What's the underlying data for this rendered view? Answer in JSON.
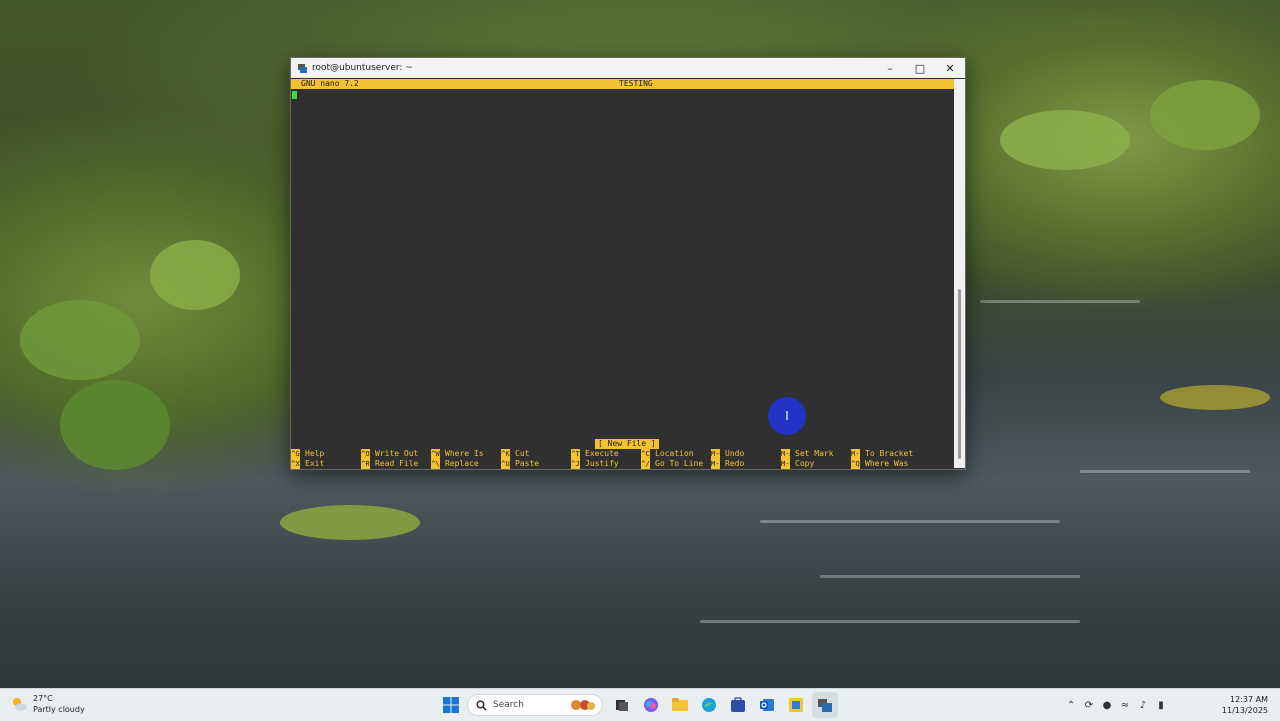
{
  "window": {
    "title": "root@ubuntuserver: ~",
    "controls": [
      "minimize",
      "maximize",
      "close"
    ]
  },
  "nano": {
    "version": "GNU nano 7.2",
    "filename": "TESTING",
    "status": "[ New File ]",
    "shortcuts": [
      {
        "key1": "^G",
        "label1": "Help",
        "key2": "^X",
        "label2": "Exit"
      },
      {
        "key1": "^O",
        "label1": "Write Out",
        "key2": "^R",
        "label2": "Read File"
      },
      {
        "key1": "^W",
        "label1": "Where Is",
        "key2": "^\\",
        "label2": "Replace"
      },
      {
        "key1": "^K",
        "label1": "Cut",
        "key2": "^U",
        "label2": "Paste"
      },
      {
        "key1": "^T",
        "label1": "Execute",
        "key2": "^J",
        "label2": "Justify"
      },
      {
        "key1": "^C",
        "label1": "Location",
        "key2": "^/",
        "label2": "Go To Line"
      },
      {
        "key1": "M-U",
        "label1": "Undo",
        "key2": "M-E",
        "label2": "Redo"
      },
      {
        "key1": "M-A",
        "label1": "Set Mark",
        "key2": "M-6",
        "label2": "Copy"
      },
      {
        "key1": "M-]",
        "label1": "To Bracket",
        "key2": "^Q",
        "label2": "Where Was"
      }
    ]
  },
  "taskbar": {
    "weather_temp": "27°C",
    "weather_desc": "Partly cloudy",
    "search_placeholder": "Search",
    "time": "12:37 AM",
    "date": "11/13/2025",
    "pinned": [
      "start-icon",
      "search",
      "task-view-icon",
      "copilot-icon",
      "file-explorer-icon",
      "edge-icon",
      "store-icon",
      "outlook-icon",
      "app-icon",
      "terminal-icon"
    ]
  },
  "colors": {
    "nano_accent": "#f2c230",
    "terminal_bg": "#303030",
    "cursor_highlight": "#2432c9"
  }
}
